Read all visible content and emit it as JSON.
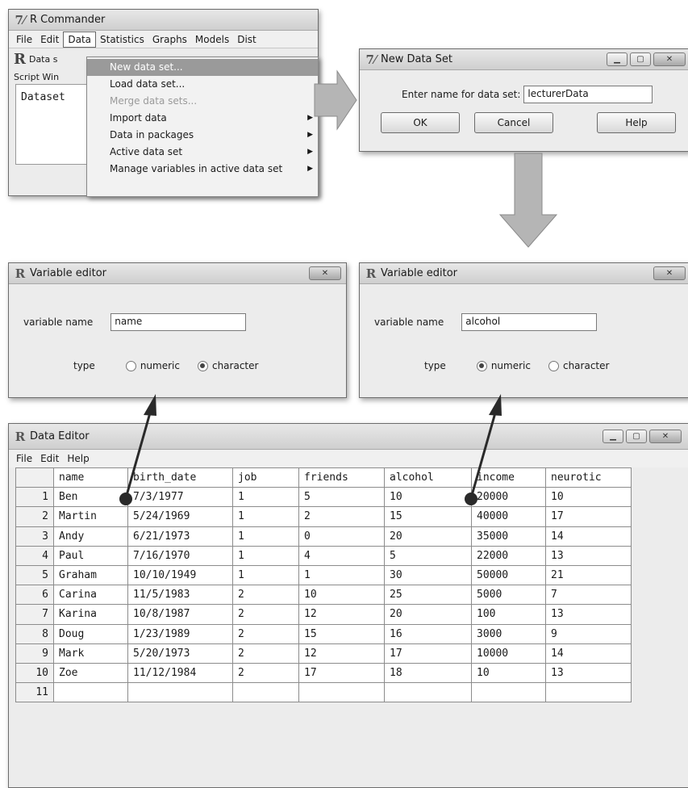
{
  "rcmdr": {
    "title": "R Commander",
    "menus": [
      "File",
      "Edit",
      "Data",
      "Statistics",
      "Graphs",
      "Models",
      "Dist"
    ],
    "toolbar_text": "Data s",
    "script_tab": "Script Win",
    "script_text": "Dataset",
    "data_menu": [
      {
        "label": "New data set...",
        "state": "highlighted",
        "submenu": false
      },
      {
        "label": "Load data set...",
        "state": "normal",
        "submenu": false
      },
      {
        "label": "Merge data sets...",
        "state": "disabled",
        "submenu": false
      },
      {
        "label": "Import data",
        "state": "normal",
        "submenu": true
      },
      {
        "label": "Data in packages",
        "state": "normal",
        "submenu": true
      },
      {
        "label": "Active data set",
        "state": "normal",
        "submenu": true
      },
      {
        "label": "Manage variables in active data set",
        "state": "normal",
        "submenu": true
      }
    ]
  },
  "new_data_set": {
    "title": "New Data Set",
    "prompt": "Enter name for data set:",
    "value": "lecturerData",
    "ok": "OK",
    "cancel": "Cancel",
    "help": "Help"
  },
  "var_editor_1": {
    "title": "Variable editor",
    "name_label": "variable name",
    "name_value": "name",
    "type_label": "type",
    "opt_numeric": "numeric",
    "opt_character": "character",
    "selected": "character"
  },
  "var_editor_2": {
    "title": "Variable editor",
    "name_label": "variable name",
    "name_value": "alcohol",
    "type_label": "type",
    "opt_numeric": "numeric",
    "opt_character": "character",
    "selected": "numeric"
  },
  "data_editor": {
    "title": "Data Editor",
    "menus": [
      "File",
      "Edit",
      "Help"
    ],
    "columns": [
      "name",
      "birth_date",
      "job",
      "friends",
      "alcohol",
      "income",
      "neurotic"
    ],
    "rows": [
      [
        "1",
        "Ben",
        "7/3/1977",
        "1",
        "5",
        "10",
        "20000",
        "10"
      ],
      [
        "2",
        "Martin",
        "5/24/1969",
        "1",
        "2",
        "15",
        "40000",
        "17"
      ],
      [
        "3",
        "Andy",
        "6/21/1973",
        "1",
        "0",
        "20",
        "35000",
        "14"
      ],
      [
        "4",
        "Paul",
        "7/16/1970",
        "1",
        "4",
        "5",
        "22000",
        "13"
      ],
      [
        "5",
        "Graham",
        "10/10/1949",
        "1",
        "1",
        "30",
        "50000",
        "21"
      ],
      [
        "6",
        "Carina",
        "11/5/1983",
        "2",
        "10",
        "25",
        "5000",
        "7"
      ],
      [
        "7",
        "Karina",
        "10/8/1987",
        "2",
        "12",
        "20",
        "100",
        "13"
      ],
      [
        "8",
        "Doug",
        "1/23/1989",
        "2",
        "15",
        "16",
        "3000",
        "9"
      ],
      [
        "9",
        "Mark",
        "5/20/1973",
        "2",
        "12",
        "17",
        "10000",
        "14"
      ],
      [
        "10",
        "Zoe",
        "11/12/1984",
        "2",
        "17",
        "18",
        "10",
        "13"
      ],
      [
        "11",
        "",
        "",
        "",
        "",
        "",
        "",
        ""
      ]
    ]
  },
  "colors": {
    "window_bg": "#ececec",
    "highlight": "#9a9a9a",
    "arrow_fill": "#b5b5b5",
    "pointer": "#2a2a2a"
  }
}
